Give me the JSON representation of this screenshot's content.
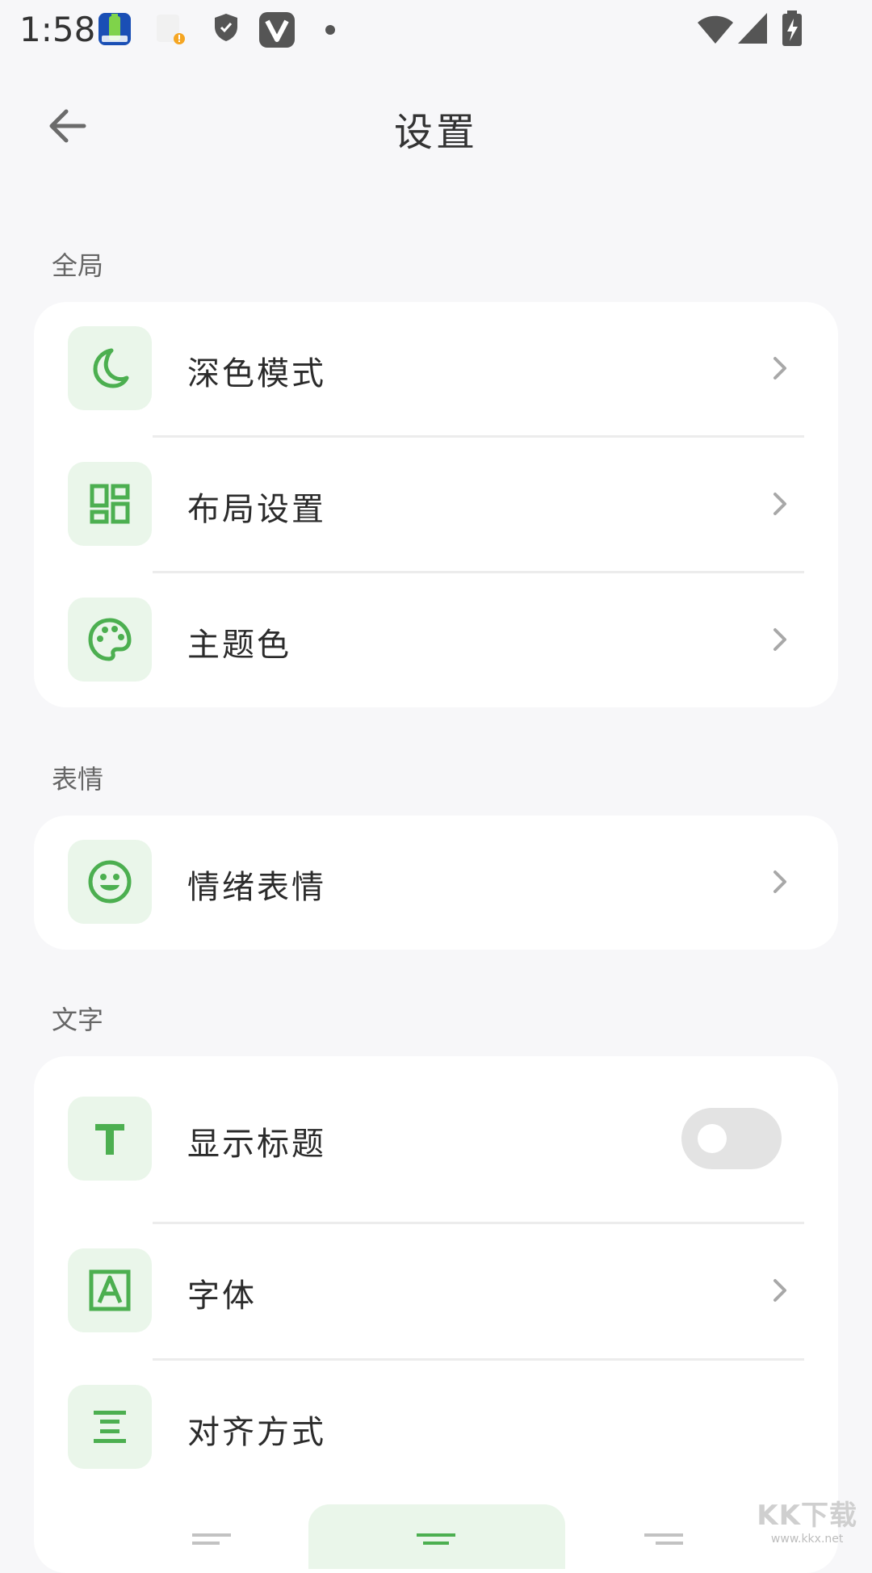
{
  "status_bar": {
    "time": "1:58",
    "icons": [
      "battery-app-icon",
      "sim-card-alert-icon",
      "shield-icon",
      "v-app-icon",
      "dot-icon",
      "wifi-icon",
      "cell-signal-icon",
      "battery-charging-icon"
    ]
  },
  "app_bar": {
    "title": "设置",
    "back_icon": "arrow-left-icon"
  },
  "sections": {
    "global": {
      "header": "全局",
      "items": [
        {
          "label": "深色模式",
          "icon": "moon-icon"
        },
        {
          "label": "布局设置",
          "icon": "dashboard-layout-icon"
        },
        {
          "label": "主题色",
          "icon": "palette-icon"
        }
      ]
    },
    "emoji": {
      "header": "表情",
      "items": [
        {
          "label": "情绪表情",
          "icon": "smiley-icon"
        }
      ]
    },
    "text": {
      "header": "文字",
      "items": [
        {
          "label": "显示标题",
          "icon": "text-t-icon",
          "toggle_on": false
        },
        {
          "label": "字体",
          "icon": "font-a-icon"
        },
        {
          "label": "对齐方式",
          "icon": "align-center-icon"
        }
      ],
      "align_options": [
        "align-left-icon",
        "align-center-icon",
        "align-right-icon"
      ],
      "align_selected": "center"
    }
  },
  "watermark": {
    "main": "KK下载",
    "sub": "www.kkx.net"
  },
  "colors": {
    "accent": "#4caf50",
    "icon_bg": "#eaf6ea",
    "background": "#f7f7f9",
    "card": "#ffffff",
    "toggle_off": "#e3e3e3"
  }
}
